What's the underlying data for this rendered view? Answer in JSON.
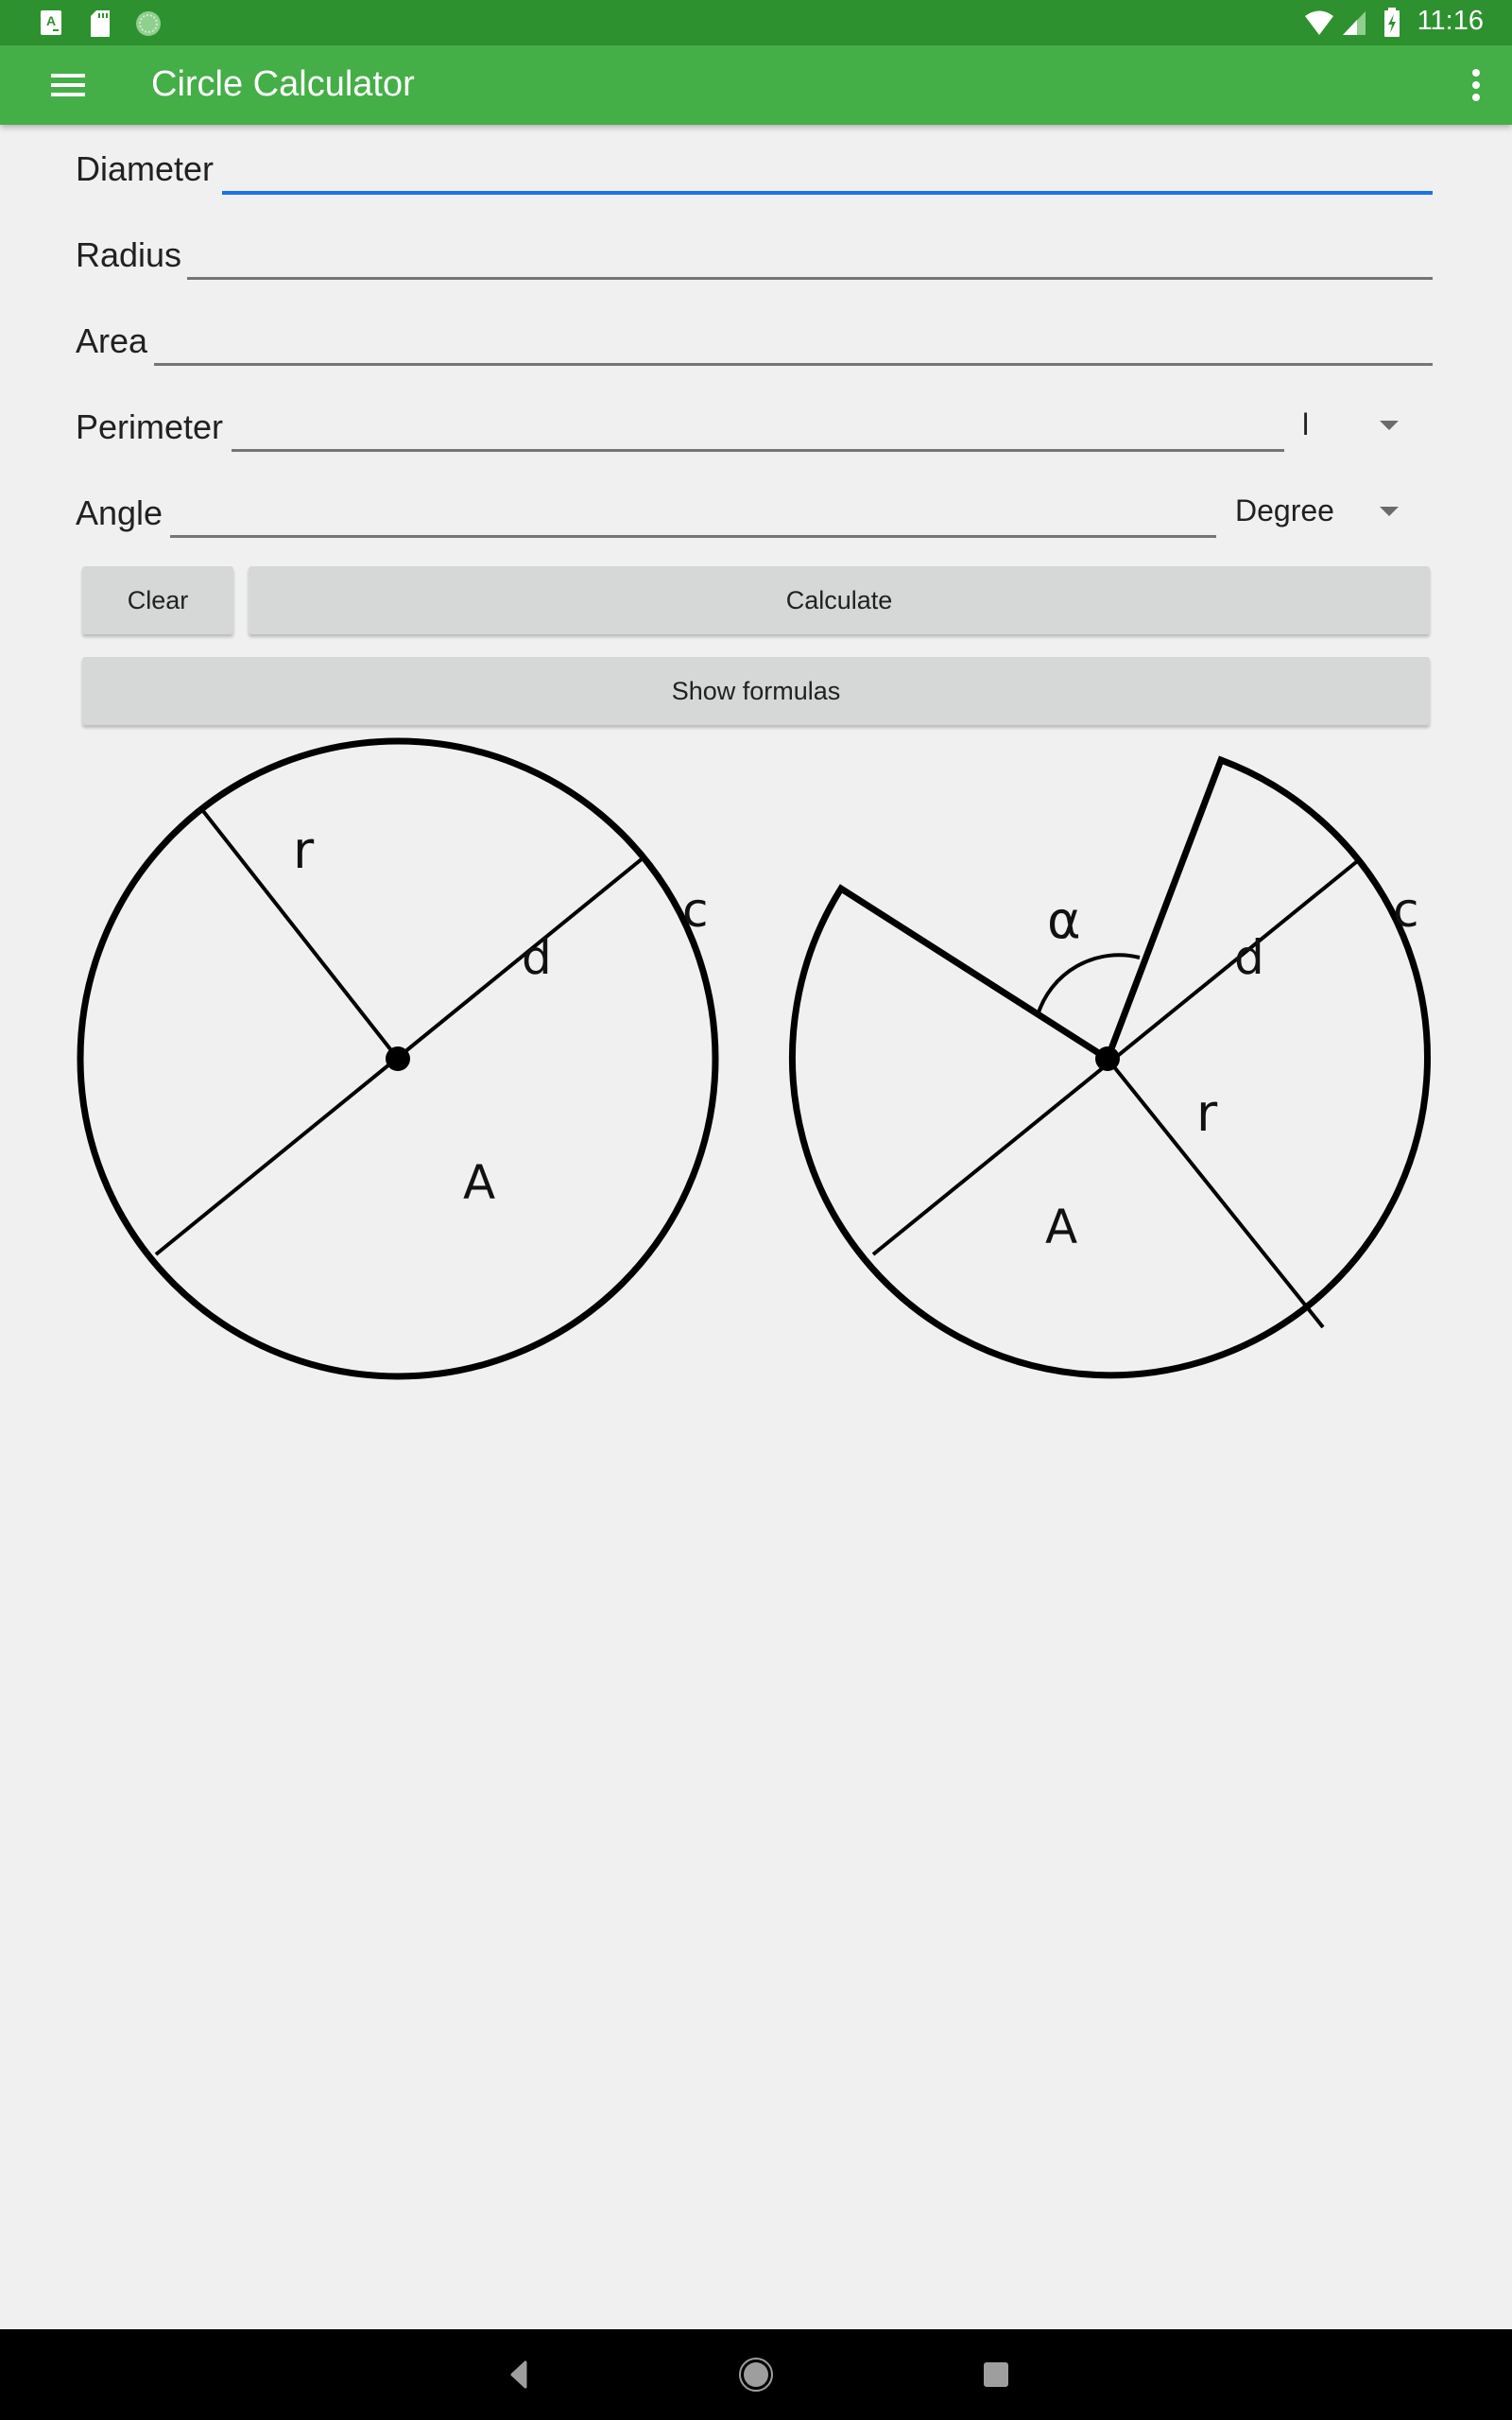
{
  "status_bar": {
    "time": "11:16",
    "left_icons": [
      "font-download-icon",
      "sd-card-icon",
      "sync-progress-icon"
    ],
    "right_icons": [
      "wifi-icon",
      "cell-signal-icon",
      "battery-charging-icon"
    ],
    "color": "#2e912f"
  },
  "app_bar": {
    "title": "Circle Calculator",
    "color": "#44ae47",
    "menu_icon": "hamburger-menu-icon",
    "overflow_icon": "more-vert-icon"
  },
  "form": {
    "diameter": {
      "label": "Diameter",
      "value": "",
      "placeholder": ""
    },
    "radius": {
      "label": "Radius",
      "value": "",
      "placeholder": ""
    },
    "area": {
      "label": "Area",
      "value": "",
      "placeholder": ""
    },
    "perimeter": {
      "label": "Perimeter",
      "value": "",
      "placeholder": "",
      "unit_selected": "l"
    },
    "angle": {
      "label": "Angle",
      "value": "",
      "placeholder": "",
      "unit_selected": "Degree"
    },
    "focus_color": "#1a73e8"
  },
  "buttons": {
    "clear": "Clear",
    "calculate": "Calculate",
    "show_formulas": "Show formulas"
  },
  "diagrams": {
    "circle": {
      "labels": {
        "radius": "r",
        "diameter": "d",
        "circumference": "c",
        "area": "A"
      }
    },
    "sector": {
      "labels": {
        "angle": "α",
        "radius": "r",
        "diameter": "d",
        "circumference": "c",
        "area": "A"
      }
    }
  },
  "nav_bar": {
    "back_icon": "back-icon",
    "home_icon": "home-icon",
    "recents_icon": "recents-icon"
  }
}
